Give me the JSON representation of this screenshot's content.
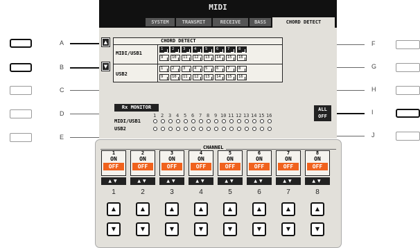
{
  "screen": {
    "title": "MIDI",
    "tabs": [
      {
        "label": "SYSTEM"
      },
      {
        "label": "TRANSMIT"
      },
      {
        "label": "RECEIVE"
      },
      {
        "label": "BASS"
      },
      {
        "label": "CHORD DETECT"
      }
    ],
    "active_tab": "CHORD DETECT",
    "chord_detect": {
      "header": "CHORD DETECT",
      "rows": [
        {
          "label": "MIDI/USB1"
        },
        {
          "label": "USB2"
        }
      ],
      "midi_usb1_on_channels": [
        1,
        2,
        3,
        4,
        5,
        6,
        7,
        8
      ],
      "channel_numbers": [
        "1",
        "2",
        "3",
        "4",
        "5",
        "6",
        "7",
        "8",
        "9",
        "10",
        "11",
        "12",
        "13",
        "14",
        "15",
        "16"
      ]
    },
    "rx_monitor": {
      "label": "Rx MONITOR",
      "rows": [
        "MIDI/USB1",
        "USB2"
      ],
      "channel_numbers": [
        "1",
        "2",
        "3",
        "4",
        "5",
        "6",
        "7",
        "8",
        "9",
        "10",
        "11",
        "12",
        "13",
        "14",
        "15",
        "16"
      ]
    },
    "all_off_label": "ALL OFF",
    "channel": {
      "header": "CHANNEL",
      "on_label": "ON",
      "off_label": "OFF",
      "channels": [
        "1",
        "2",
        "3",
        "4",
        "5",
        "6",
        "7",
        "8"
      ]
    }
  },
  "side_buttons": {
    "left": [
      "A",
      "B",
      "C",
      "D",
      "E"
    ],
    "right": [
      "F",
      "G",
      "H",
      "I",
      "J"
    ]
  },
  "physical_buttons": [
    "1",
    "2",
    "3",
    "4",
    "5",
    "6",
    "7",
    "8"
  ],
  "icons": {
    "up": "▲",
    "down": "▼",
    "up_down": "▲▼"
  },
  "colors": {
    "off_highlight": "#f0621d",
    "screen_bg": "#e2e0da",
    "top_bar": "#111111"
  }
}
